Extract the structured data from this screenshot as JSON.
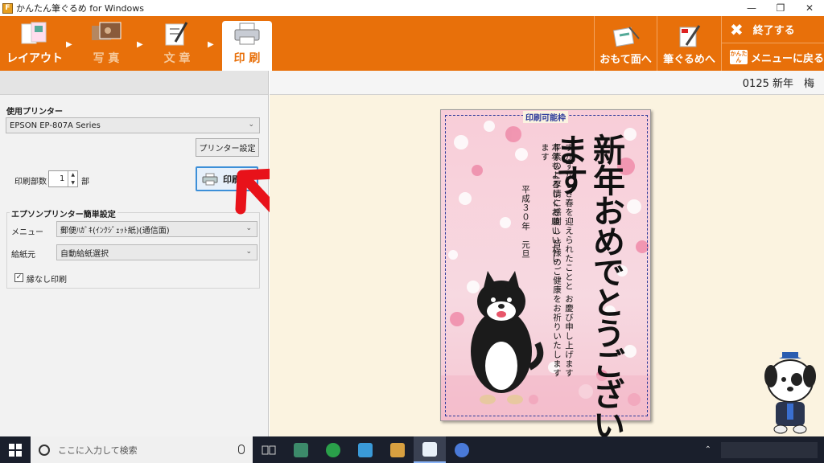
{
  "window": {
    "title": "かんたん筆ぐるめ for Windows",
    "icon_letter": "F"
  },
  "toolbar": {
    "tabs": [
      {
        "label": "レイアウト",
        "icon": "layout-icon"
      },
      {
        "label": "写 真",
        "icon": "photo-icon"
      },
      {
        "label": "文 章",
        "icon": "text-pen-icon"
      },
      {
        "label": "印 刷",
        "icon": "printer-icon"
      }
    ],
    "active_tab": "印 刷",
    "omote_label": "おもて面へ",
    "fudegurume_label": "筆ぐるめへ",
    "exit_label": "終了する",
    "menu_return_label": "メニューに戻る",
    "kantan_badge": "かんたん"
  },
  "left_panel": {
    "printer_heading": "使用プリンター",
    "printer_value": "EPSON EP-807A Series",
    "printer_settings_button": "プリンター設定",
    "copies_label": "印刷部数",
    "copies_value": "1",
    "copies_unit": "部",
    "print_button": "印刷",
    "epson_group_heading": "エプソンプリンター簡単設定",
    "menu_label": "メニュー",
    "menu_value": "郵便ﾊｶﾞｷ(ｲﾝｸｼﾞｪｯﾄ紙)(通信面)",
    "paper_source_label": "給紙元",
    "paper_source_value": "自動給紙選択",
    "borderless_label": "縁なし印刷",
    "borderless_checked": true
  },
  "preview": {
    "template_name": "0125 新年　梅",
    "frame_label": "印刷可能枠",
    "card_title": "新年おめでとうございます",
    "message_lines": [
      "すがすがしき春を迎えられたことと お慶び申し上げます",
      "平素のご厚情に感謝し 皆様のご健康をお祈りいたします",
      "本年もよろしくお願いいたします"
    ],
    "date_line": "平成３０年　元旦"
  },
  "taskbar": {
    "search_placeholder": "ここに入力して検索"
  },
  "colors": {
    "toolbar_orange": "#e8700a",
    "accent_blue": "#3c8fd8",
    "annotation_red": "#e8121a"
  }
}
